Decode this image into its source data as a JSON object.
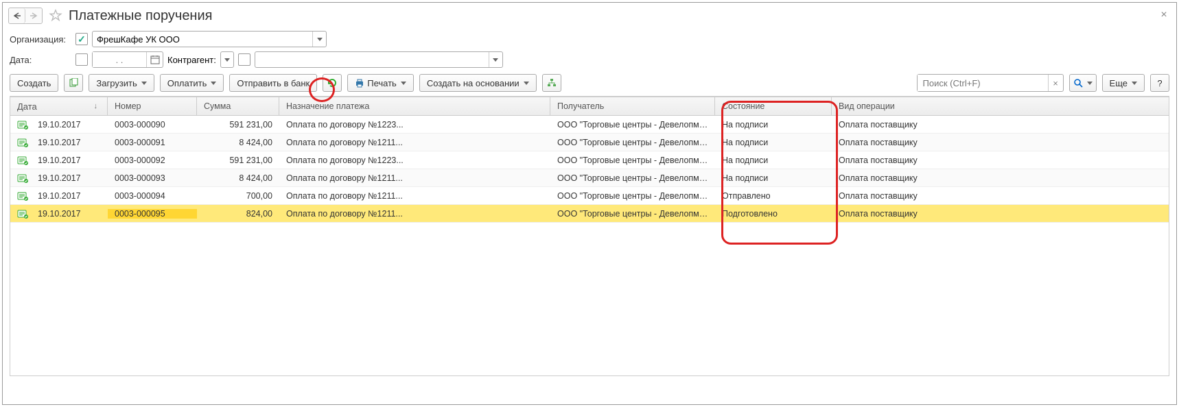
{
  "title": "Платежные поручения",
  "filters": {
    "org_label": "Организация:",
    "org_value": "ФрешКафе УК ООО",
    "date_label": "Дата:",
    "date_placeholder": ". .",
    "contr_label": "Контрагент:"
  },
  "toolbar": {
    "create": "Создать",
    "load": "Загрузить",
    "pay": "Оплатить",
    "send_bank": "Отправить в банк",
    "print": "Печать",
    "create_based": "Создать на основании",
    "more": "Еще",
    "help": "?",
    "search_placeholder": "Поиск (Ctrl+F)"
  },
  "columns": {
    "date": "Дата",
    "num": "Номер",
    "sum": "Сумма",
    "desc": "Назначение платежа",
    "recv": "Получатель",
    "state": "Состояние",
    "op": "Вид операции"
  },
  "rows": [
    {
      "date": "19.10.2017",
      "num": "0003-000090",
      "sum": "591 231,00",
      "desc": "Оплата по договору №1223...",
      "recv": "ООО \"Торговые центры - Девелопмент\"",
      "state": "На подписи",
      "op": "Оплата поставщику",
      "sel": false
    },
    {
      "date": "19.10.2017",
      "num": "0003-000091",
      "sum": "8 424,00",
      "desc": "Оплата по договору №1211...",
      "recv": "ООО \"Торговые центры - Девелопмент\"",
      "state": "На подписи",
      "op": "Оплата поставщику",
      "sel": false
    },
    {
      "date": "19.10.2017",
      "num": "0003-000092",
      "sum": "591 231,00",
      "desc": "Оплата по договору №1223...",
      "recv": "ООО \"Торговые центры - Девелопмент\"",
      "state": "На подписи",
      "op": "Оплата поставщику",
      "sel": false
    },
    {
      "date": "19.10.2017",
      "num": "0003-000093",
      "sum": "8 424,00",
      "desc": "Оплата по договору №1211...",
      "recv": "ООО \"Торговые центры - Девелопмент\"",
      "state": "На подписи",
      "op": "Оплата поставщику",
      "sel": false
    },
    {
      "date": "19.10.2017",
      "num": "0003-000094",
      "sum": "700,00",
      "desc": "Оплата по договору №1211...",
      "recv": "ООО \"Торговые центры - Девелопмент\"",
      "state": "Отправлено",
      "op": "Оплата поставщику",
      "sel": false
    },
    {
      "date": "19.10.2017",
      "num": "0003-000095",
      "sum": "824,00",
      "desc": "Оплата по договору №1211...",
      "recv": "ООО \"Торговые центры - Девелопмент\"",
      "state": "Подготовлено",
      "op": "Оплата поставщику",
      "sel": true
    }
  ]
}
